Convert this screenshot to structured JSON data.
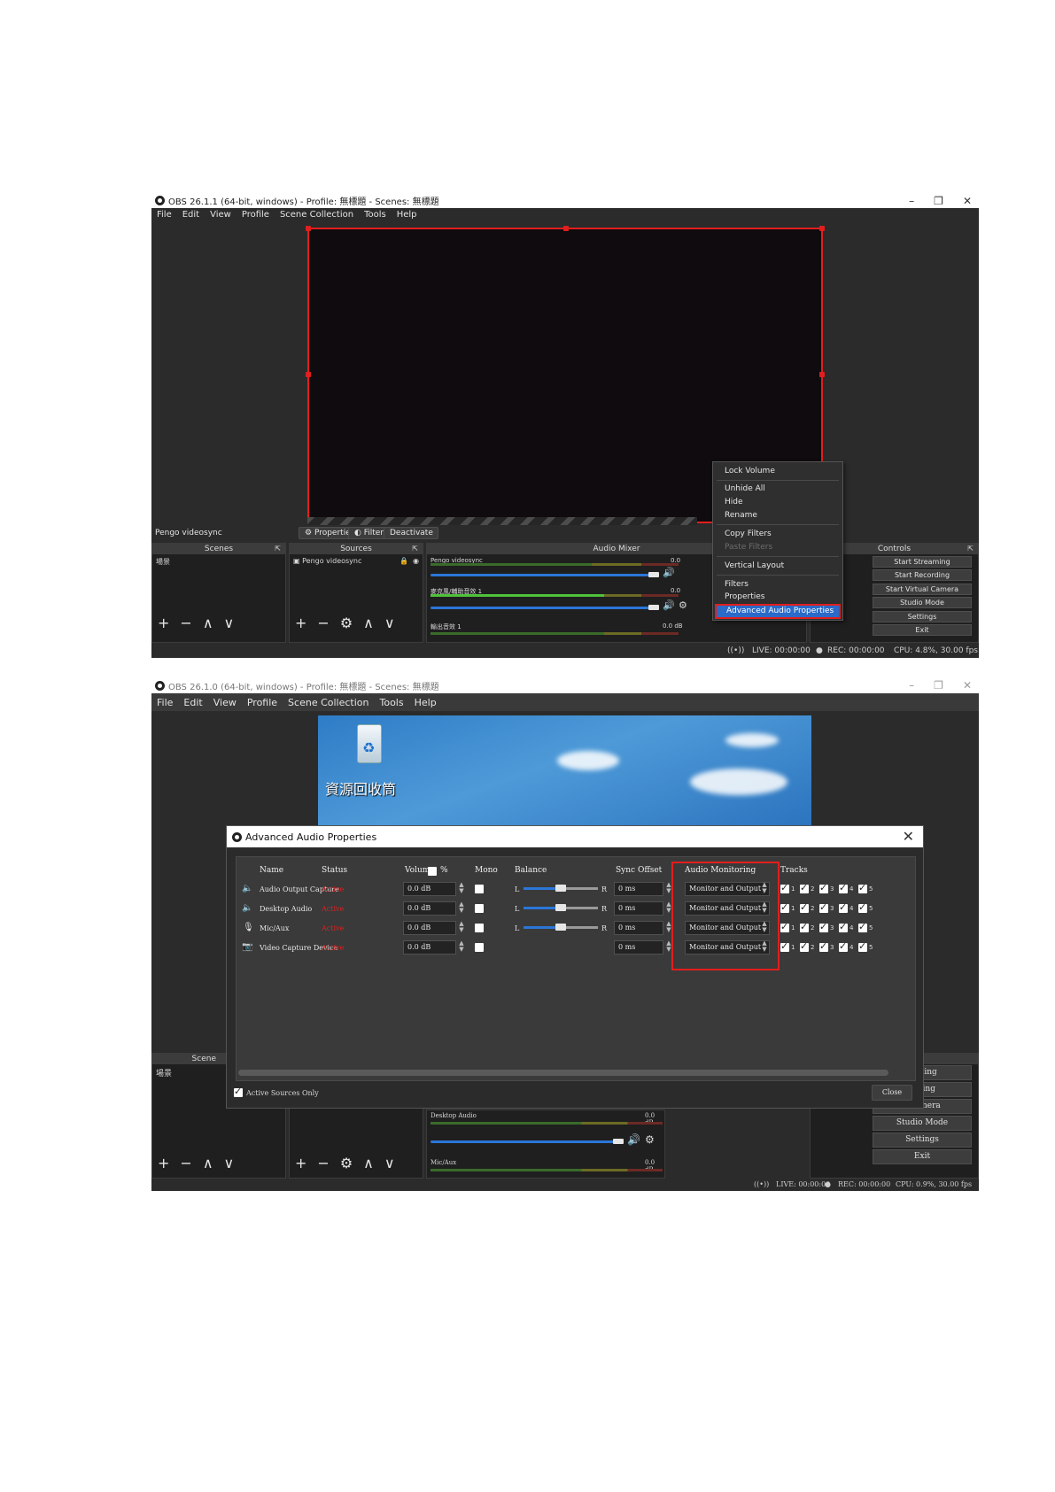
{
  "window1": {
    "title": "OBS 26.1.1 (64-bit, windows) - Profile: 無標題 - Scenes: 無標題",
    "window_controls": [
      "–",
      "❐",
      "✕"
    ],
    "menu": [
      "File",
      "Edit",
      "View",
      "Profile",
      "Scene Collection",
      "Tools",
      "Help"
    ],
    "source_name": "Pengo videosync",
    "buttons": {
      "properties": "Properties",
      "filters": "Filters",
      "deactivate": "Deactivate"
    },
    "docks": {
      "scenes": "Scenes",
      "sources": "Sources",
      "mixer": "Audio Mixer",
      "controls": "Controls"
    },
    "scene_item": "場景",
    "source_item": "Pengo videosync",
    "mixer": {
      "track1": "Pengo videosync",
      "track1_db": "0.0",
      "track2": "麥克風/輔助音效 1",
      "track2_db": "0.0",
      "track3": "輸出音效 1",
      "track3_db": "0.0 dB"
    },
    "context_menu": {
      "lock_volume": "Lock Volume",
      "unhide_all": "Unhide All",
      "hide": "Hide",
      "rename": "Rename",
      "copy_filters": "Copy Filters",
      "paste_filters": "Paste Filters",
      "vertical_layout": "Vertical Layout",
      "filters": "Filters",
      "properties": "Properties",
      "advanced_audio": "Advanced Audio Properties"
    },
    "controls": [
      "Start Streaming",
      "Start Recording",
      "Start Virtual Camera",
      "Studio Mode",
      "Settings",
      "Exit"
    ],
    "status": {
      "live": "LIVE: 00:00:00",
      "rec": "REC: 00:00:00",
      "cpu": "CPU: 4.8%, 30.00 fps"
    }
  },
  "window2": {
    "title": "OBS 26.1.0 (64-bit, windows) - Profile: 無標題 - Scenes: 無標題",
    "window_controls": [
      "–",
      "❐",
      "✕"
    ],
    "menu": [
      "File",
      "Edit",
      "View",
      "Profile",
      "Scene Collection",
      "Tools",
      "Help"
    ],
    "desktop_icon_label": "資源回收筒",
    "scenes_partial": "Scene",
    "scene_item": "場景",
    "controls_partial": [
      "ls",
      "eaming",
      "ording",
      "l Camera",
      "Studio Mode",
      "Settings",
      "Exit"
    ],
    "mixer": {
      "desktop_audio": "Desktop Audio",
      "desktop_db": "0.0 dB",
      "mic": "Mic/Aux",
      "mic_db": "0.0 dB"
    },
    "status": {
      "live": "LIVE: 00:00:00",
      "rec": "REC: 00:00:00",
      "cpu": "CPU: 0.9%, 30.00 fps"
    },
    "dialog": {
      "title": "Advanced Audio Properties",
      "columns": {
        "name": "Name",
        "status": "Status",
        "volume": "Volume",
        "percent": "%",
        "mono": "Mono",
        "balance": "Balance",
        "sync": "Sync Offset",
        "monitoring": "Audio Monitoring",
        "tracks": "Tracks"
      },
      "balance_left": "L",
      "balance_right": "R",
      "rows": [
        {
          "name": "Audio Output Capture",
          "status": "Active",
          "volume": "0.0 dB",
          "sync": "0 ms",
          "monitoring": "Monitor and Output",
          "balance": 0.5
        },
        {
          "name": "Desktop Audio",
          "status": "Active",
          "volume": "0.0 dB",
          "sync": "0 ms",
          "monitoring": "Monitor and Output",
          "balance": 0.5
        },
        {
          "name": "Mic/Aux",
          "status": "Active",
          "volume": "0.0 dB",
          "sync": "0 ms",
          "monitoring": "Monitor and Output",
          "balance": 0.5
        },
        {
          "name": "Video Capture Device",
          "status": "Active",
          "volume": "0.0 dB",
          "sync": "0 ms",
          "monitoring": "Monitor and Output"
        }
      ],
      "track_numbers": [
        "1",
        "2",
        "3",
        "4",
        "5"
      ],
      "active_only": "Active Sources Only",
      "close": "Close"
    }
  },
  "colors": {
    "highlight_red": "#e21e1e",
    "selection_blue": "#2a6ac8",
    "obs_dark": "#2b2b2b"
  }
}
